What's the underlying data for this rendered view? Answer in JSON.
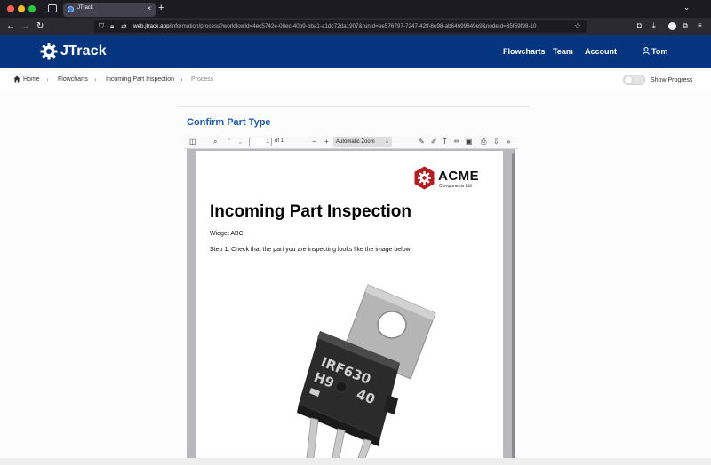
{
  "browser": {
    "tab_title": "JTrack",
    "tab_close": "×",
    "new_tab": "+",
    "url_host": "web.jtrack.app",
    "url_path": "/information/process?workflowId=4ec5742e-08ec-40b9-bba1-a1dc72da1907&runId=ee576797-7247-42ff-8e98-ab64699849e9&nodeId=35f59f98-10",
    "back": "←",
    "forward": "→",
    "reload": "↻",
    "star": "☆"
  },
  "app": {
    "logo_text": "JTrack",
    "nav": {
      "flowcharts": "Flowcharts",
      "team": "Team",
      "account": "Account",
      "user": "Tom"
    },
    "brand_color": "#063580"
  },
  "breadcrumb": {
    "items": [
      "Home",
      "Flowcharts",
      "Incoming Part Inspection",
      "Process"
    ],
    "separator": "›"
  },
  "show_progress": {
    "label": "Show Progress",
    "on": false
  },
  "step": {
    "title": "Confirm Part Type"
  },
  "pdf_viewer": {
    "page_number": "1",
    "page_of": "of 1",
    "zoom_value": "Automatic Zoom",
    "zoom_out": "−",
    "zoom_in": "+"
  },
  "document": {
    "company_name": "ACME",
    "company_sub": "Components Ltd",
    "title": "Incoming Part Inspection",
    "subtitle": "Widget ABC",
    "step_text": "Step 1: Check that the part you are inspecting looks like the image below.",
    "part_marking_line1": "IRF630",
    "part_marking_line2": "H9",
    "part_marking_line3": "40",
    "accent_color": "#b01e23"
  }
}
